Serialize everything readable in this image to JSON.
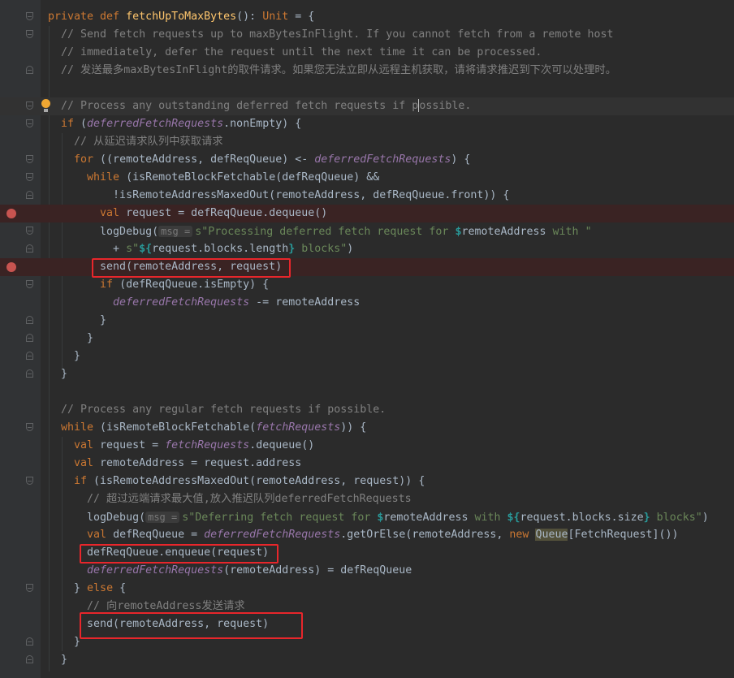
{
  "colors": {
    "background": "#2b2b2b",
    "keyword": "#cc7832",
    "comment": "#808080",
    "field": "#9876aa",
    "string": "#6a8759",
    "breakpoint": "#c75450",
    "annotation_box": "#e8262b"
  },
  "lines": [
    {
      "tokens": [
        [
          "kw",
          "private def "
        ],
        [
          "fn",
          "fetchUpToMaxBytes"
        ],
        [
          "tx",
          "(): "
        ],
        [
          "kw",
          "Unit"
        ],
        [
          "tx",
          " = {"
        ]
      ],
      "fold": "start"
    },
    {
      "tokens": [
        [
          "cm",
          "  // Send fetch requests up to maxBytesInFlight. If you cannot fetch from a remote host"
        ]
      ],
      "fold": "start"
    },
    {
      "tokens": [
        [
          "cm",
          "  // immediately, defer the request until the next time it can be processed."
        ]
      ]
    },
    {
      "tokens": [
        [
          "cm",
          "  // 发送最多maxBytesInFlight的取件请求。如果您无法立即从远程主机获取，请将请求推迟到下次可以处理时。"
        ]
      ],
      "fold": "end"
    },
    {
      "tokens": []
    },
    {
      "tokens": [
        [
          "cm",
          "  // Process any outstanding deferred fetch requests if p"
        ],
        [
          "caret",
          ""
        ],
        [
          "cm",
          "ossible."
        ]
      ],
      "fold": "start",
      "current": true,
      "bulb": true
    },
    {
      "tokens": [
        [
          "kw",
          "  if "
        ],
        [
          "tx",
          "("
        ],
        [
          "it",
          "deferredFetchRequests"
        ],
        [
          "tx",
          ".nonEmpty) {"
        ]
      ],
      "fold": "start"
    },
    {
      "tokens": [
        [
          "cm",
          "    // 从延迟请求队列中获取请求"
        ]
      ]
    },
    {
      "tokens": [
        [
          "kw",
          "    for "
        ],
        [
          "tx",
          "((remoteAddress, defReqQueue) <- "
        ],
        [
          "it",
          "deferredFetchRequests"
        ],
        [
          "tx",
          ") {"
        ]
      ],
      "fold": "start"
    },
    {
      "tokens": [
        [
          "kw",
          "      while "
        ],
        [
          "tx",
          "(isRemoteBlockFetchable(defReqQueue) &&"
        ]
      ],
      "fold": "start"
    },
    {
      "tokens": [
        [
          "tx",
          "          !isRemoteAddressMaxedOut(remoteAddress, defReqQueue.front)) {"
        ]
      ],
      "fold": "end"
    },
    {
      "tokens": [
        [
          "kw",
          "        val "
        ],
        [
          "tx",
          "request = defReqQueue.dequeue()"
        ]
      ],
      "breakpoint": true
    },
    {
      "tokens": [
        [
          "tx",
          "        logDebug("
        ],
        [
          "hint",
          "msg ="
        ],
        [
          "str",
          "s\"Processing deferred fetch request for "
        ],
        [
          "dol",
          "$"
        ],
        [
          "tx",
          "remoteAddress"
        ],
        [
          "str",
          " with \""
        ]
      ],
      "fold": "start"
    },
    {
      "tokens": [
        [
          "tx",
          "          + "
        ],
        [
          "str",
          "s\""
        ],
        [
          "dol",
          "${"
        ],
        [
          "tx",
          "request.blocks.length"
        ],
        [
          "dol",
          "}"
        ],
        [
          "str",
          " blocks\""
        ],
        [
          "tx",
          ")"
        ]
      ],
      "fold": "end"
    },
    {
      "tokens": [
        [
          "tx",
          "        send(remoteAddress, request)"
        ]
      ],
      "breakpoint": true
    },
    {
      "tokens": [
        [
          "kw",
          "        if "
        ],
        [
          "tx",
          "(defReqQueue.isEmpty) {"
        ]
      ],
      "fold": "start"
    },
    {
      "tokens": [
        [
          "it",
          "          deferredFetchRequests"
        ],
        [
          "tx",
          " -= remoteAddress"
        ]
      ]
    },
    {
      "tokens": [
        [
          "tx",
          "        }"
        ]
      ],
      "fold": "end"
    },
    {
      "tokens": [
        [
          "tx",
          "      }"
        ]
      ],
      "fold": "end"
    },
    {
      "tokens": [
        [
          "tx",
          "    }"
        ]
      ],
      "fold": "end"
    },
    {
      "tokens": [
        [
          "tx",
          "  }"
        ]
      ],
      "fold": "end"
    },
    {
      "tokens": []
    },
    {
      "tokens": [
        [
          "cm",
          "  // Process any regular fetch requests if possible."
        ]
      ]
    },
    {
      "tokens": [
        [
          "kw",
          "  while "
        ],
        [
          "tx",
          "(isRemoteBlockFetchable("
        ],
        [
          "it",
          "fetchRequests"
        ],
        [
          "tx",
          ")) {"
        ]
      ],
      "fold": "start"
    },
    {
      "tokens": [
        [
          "kw",
          "    val "
        ],
        [
          "tx",
          "request = "
        ],
        [
          "it",
          "fetchRequests"
        ],
        [
          "tx",
          ".dequeue()"
        ]
      ]
    },
    {
      "tokens": [
        [
          "kw",
          "    val "
        ],
        [
          "tx",
          "remoteAddress = request.address"
        ]
      ]
    },
    {
      "tokens": [
        [
          "kw",
          "    if "
        ],
        [
          "tx",
          "(isRemoteAddressMaxedOut(remoteAddress, request)) {"
        ]
      ],
      "fold": "start"
    },
    {
      "tokens": [
        [
          "cm",
          "      // 超过远端请求最大值,放入推迟队列deferredFetchRequests"
        ]
      ]
    },
    {
      "tokens": [
        [
          "tx",
          "      logDebug("
        ],
        [
          "hint",
          "msg ="
        ],
        [
          "str",
          "s\"Deferring fetch request for "
        ],
        [
          "dol",
          "$"
        ],
        [
          "tx",
          "remoteAddress"
        ],
        [
          "str",
          " with "
        ],
        [
          "dol",
          "${"
        ],
        [
          "tx",
          "request.blocks.size"
        ],
        [
          "dol",
          "}"
        ],
        [
          "str",
          " blocks\""
        ],
        [
          "tx",
          ")"
        ]
      ]
    },
    {
      "tokens": [
        [
          "kw",
          "      val "
        ],
        [
          "tx",
          "defReqQueue = "
        ],
        [
          "it",
          "deferredFetchRequests"
        ],
        [
          "tx",
          ".getOrElse(remoteAddress, "
        ],
        [
          "kw",
          "new "
        ],
        [
          "hl",
          "Queue"
        ],
        [
          "tx",
          "[FetchRequest]())"
        ]
      ]
    },
    {
      "tokens": [
        [
          "tx",
          "      defReqQueue.enqueue(request)"
        ]
      ]
    },
    {
      "tokens": [
        [
          "it",
          "      deferredFetchRequests"
        ],
        [
          "tx",
          "(remoteAddress) = defReqQueue"
        ]
      ]
    },
    {
      "tokens": [
        [
          "tx",
          "    } "
        ],
        [
          "kw",
          "else "
        ],
        [
          "tx",
          "{"
        ]
      ],
      "fold": "start"
    },
    {
      "tokens": [
        [
          "cm",
          "      // 向remoteAddress发送请求"
        ]
      ]
    },
    {
      "tokens": [
        [
          "tx",
          "      send(remoteAddress, request)"
        ]
      ]
    },
    {
      "tokens": [
        [
          "tx",
          "    }"
        ]
      ],
      "fold": "end"
    },
    {
      "tokens": [
        [
          "tx",
          "  }"
        ]
      ],
      "fold": "end"
    }
  ]
}
